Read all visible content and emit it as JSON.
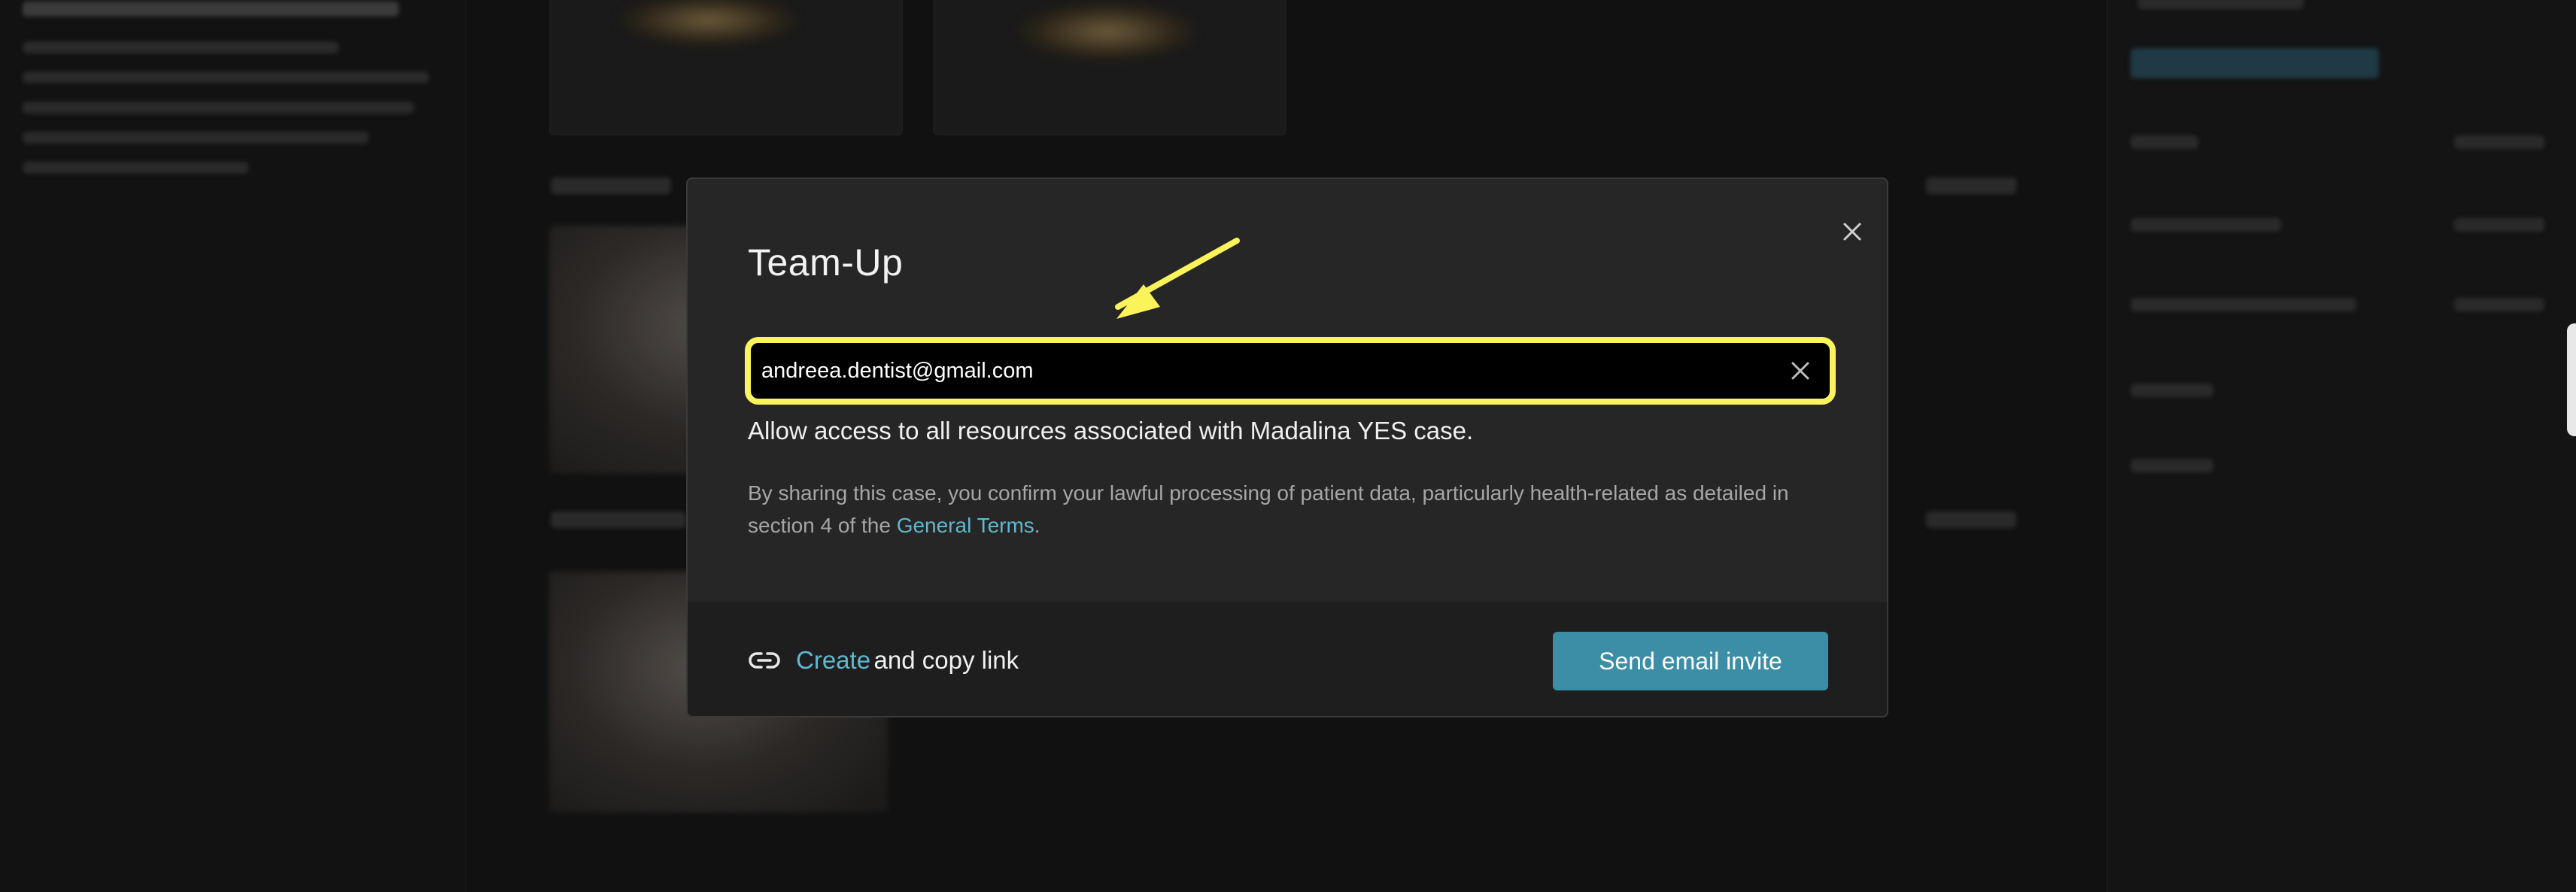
{
  "modal": {
    "title": "Team-Up",
    "email_input_value": "andreea.dentist@gmail.com",
    "allow_text": "Allow access to all resources associated with Madalina YES case.",
    "consent_text": "By sharing this case, you confirm your lawful processing of patient data, particularly health-related as detailed in section 4 of the ",
    "terms_link": "General Terms",
    "consent_end": ".",
    "footer": {
      "create_link": "Create",
      "copy_text": "and copy link",
      "send_button": "Send email invite"
    }
  },
  "icons": {
    "close": "close-icon",
    "clear": "clear-input-icon",
    "link": "link-icon",
    "annotation": "arrow-annotation"
  },
  "colors": {
    "accent": "#3b8ea6",
    "link": "#5fb8cf",
    "highlight": "#fbf35a",
    "modal_bg": "#262626"
  }
}
